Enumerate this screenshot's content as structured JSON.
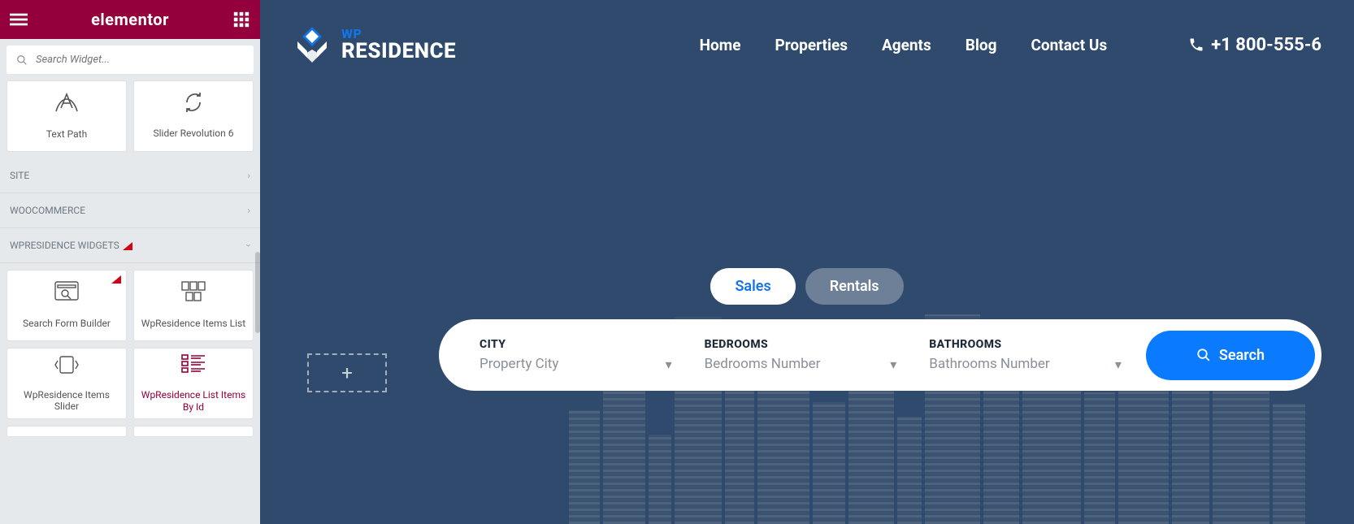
{
  "sidebar": {
    "brand": "elementor",
    "search_placeholder": "Search Widget...",
    "top_widgets": [
      {
        "label": "Text Path"
      },
      {
        "label": "Slider Revolution 6"
      }
    ],
    "categories": [
      {
        "label": "SITE"
      },
      {
        "label": "WOOCOMMERCE"
      },
      {
        "label": "WPRESIDENCE WIDGETS"
      }
    ],
    "wp_widgets": [
      {
        "label": "Search Form Builder"
      },
      {
        "label": "WpResidence Items List"
      },
      {
        "label": "WpResidence Items Slider"
      },
      {
        "label": "WpResidence List Items By Id"
      }
    ]
  },
  "preview": {
    "logo_wp": "WP",
    "logo_res": "RESIDENCE",
    "nav": [
      {
        "label": "Home"
      },
      {
        "label": "Properties"
      },
      {
        "label": "Agents"
      },
      {
        "label": "Blog"
      },
      {
        "label": "Contact Us"
      }
    ],
    "phone": "+1 800-555-6",
    "tabs": {
      "active": "Sales",
      "inactive": "Rentals"
    },
    "search": {
      "city_label": "CITY",
      "city_placeholder": "Property City",
      "bedrooms_label": "BEDROOMS",
      "bedrooms_placeholder": "Bedrooms Number",
      "bathrooms_label": "BATHROOMS",
      "bathrooms_placeholder": "Bathrooms Number",
      "button": "Search"
    },
    "dropzone": "+"
  }
}
